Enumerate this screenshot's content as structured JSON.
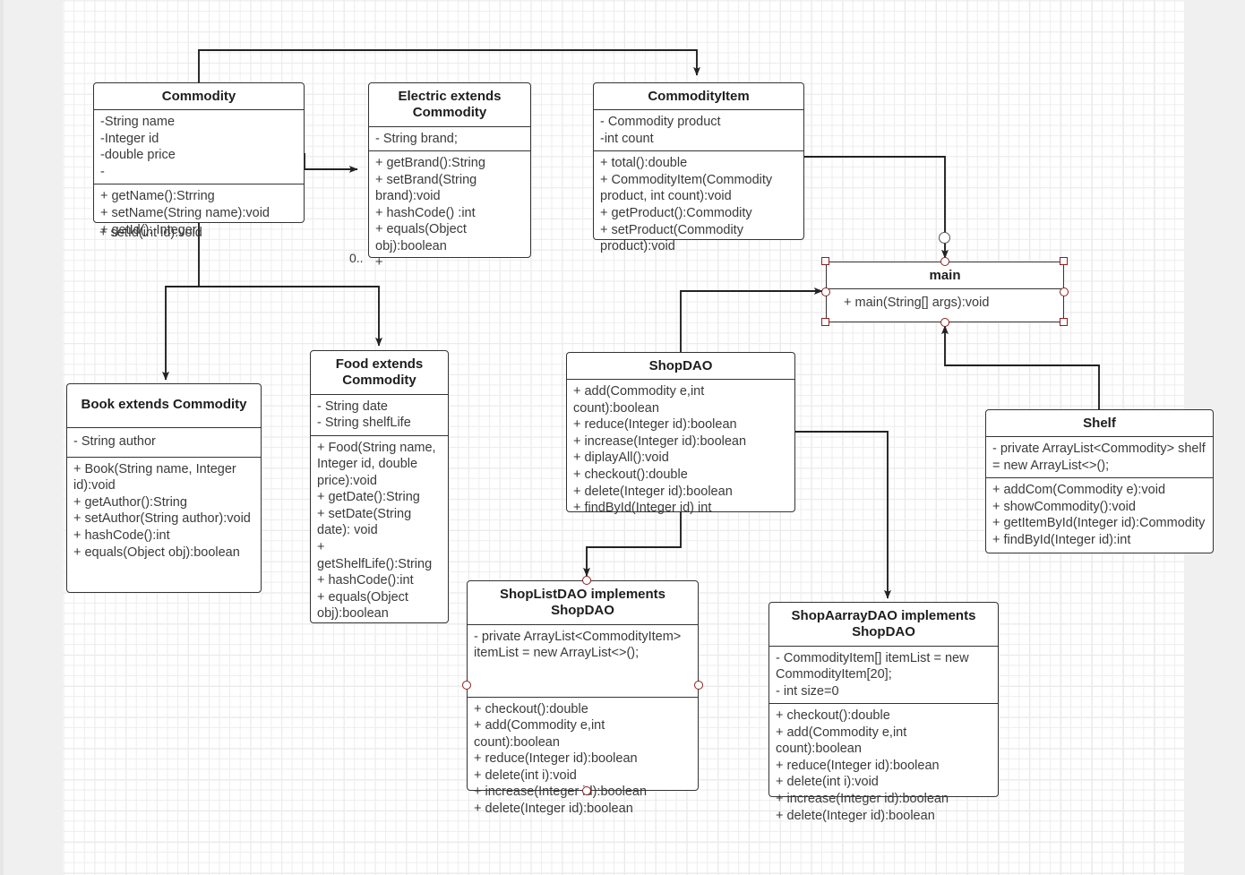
{
  "canvas": {
    "background": "#ffffff",
    "grid_color": "#e2e2e2",
    "page_background": "#f0f0f0"
  },
  "diagram": {
    "type": "uml-class-diagram",
    "stroke_color": "#333333",
    "selection_color": "#8c2020",
    "classes": [
      {
        "id": "commodity",
        "title": "Commodity",
        "attributes": [
          "-String name",
          "-Integer id",
          "-double price",
          "-"
        ],
        "methods": [
          "+ getName():Strring",
          "+ setName(String name):void",
          "+ getId(): Integer"
        ],
        "overflow_methods": [
          "+ setId(int id):void"
        ]
      },
      {
        "id": "electric",
        "title": "Electric extends Commodity",
        "attributes": [
          "- String brand;"
        ],
        "methods": [
          "+ getBrand():String",
          "+ setBrand(String brand):void",
          "+ hashCode() :int",
          "+ equals(Object obj):boolean",
          "+"
        ],
        "overflow_methods": []
      },
      {
        "id": "commodityitem",
        "title": "CommodityItem",
        "attributes": [
          "- Commodity product",
          "-int count"
        ],
        "methods": [
          "+ total():double",
          "+ CommodityItem(Commodity product, int count):void",
          "+ getProduct():Commodity",
          "+ setProduct(Commodity product):void"
        ],
        "overflow_methods": []
      },
      {
        "id": "main",
        "title": "main",
        "attributes": [],
        "methods": [
          "+ main(String[] args):void"
        ],
        "overflow_methods": [],
        "selected": true
      },
      {
        "id": "book",
        "title": "Book extends Commodity",
        "attributes": [
          "- String author"
        ],
        "methods": [
          "+ Book(String name, Integer id):void",
          "+ getAuthor():String",
          "+ setAuthor(String author):void",
          "+ hashCode():int",
          "+ equals(Object obj):boolean"
        ],
        "overflow_methods": []
      },
      {
        "id": "food",
        "title": "Food extends Commodity",
        "attributes": [
          "- String date",
          "- String shelfLife"
        ],
        "methods": [
          "+ Food(String name, Integer id, double price):void",
          "+ getDate():String",
          "+ setDate(String date): void",
          "+ getShelfLife():String",
          "+ hashCode():int",
          "+ equals(Object obj):boolean"
        ],
        "overflow_methods": []
      },
      {
        "id": "shopdao",
        "title": "ShopDAO",
        "attributes": [],
        "methods": [
          "+ add(Commodity e,int count):boolean",
          "+ reduce(Integer id):boolean",
          "+ increase(Integer id):boolean",
          "+ diplayAll():void",
          "+ checkout():double",
          "+ delete(Integer id):boolean",
          "+ findById(Integer id) int"
        ],
        "overflow_methods": []
      },
      {
        "id": "shelf",
        "title": "Shelf",
        "attributes": [
          "- private ArrayList<Commodity> shelf = new  ArrayList<>();"
        ],
        "methods": [
          "+ addCom(Commodity e):void",
          "+ showCommodity():void",
          "+ getItemById(Integer id):Commodity",
          "+ findById(Integer id):int"
        ],
        "overflow_methods": []
      },
      {
        "id": "shoplistdao",
        "title": "ShopListDAO implements ShopDAO",
        "attributes": [
          "- private ArrayList<CommodityItem> itemList = new ArrayList<>();"
        ],
        "methods": [
          "+ checkout():double",
          "+ add(Commodity e,int count):boolean",
          "+ reduce(Integer id):boolean",
          "+ delete(int i):void",
          "+ increase(Integer id):boolean",
          "+ delete(Integer id):boolean"
        ],
        "overflow_methods": []
      },
      {
        "id": "shoparraydao",
        "title": "ShopAarrayDAO implements ShopDAO",
        "attributes": [
          "- CommodityItem[] itemList = new CommodityItem[20];",
          "- int size=0"
        ],
        "methods": [
          "+ checkout():double",
          "+ add(Commodity e,int count):boolean",
          "+ reduce(Integer id):boolean",
          "+ delete(int i):void",
          "+ increase(Integer id):boolean",
          "+ delete(Integer id):boolean"
        ],
        "overflow_methods": []
      }
    ],
    "edge_labels": [
      {
        "id": "electric-multiplicity",
        "text": "0.."
      }
    ]
  }
}
